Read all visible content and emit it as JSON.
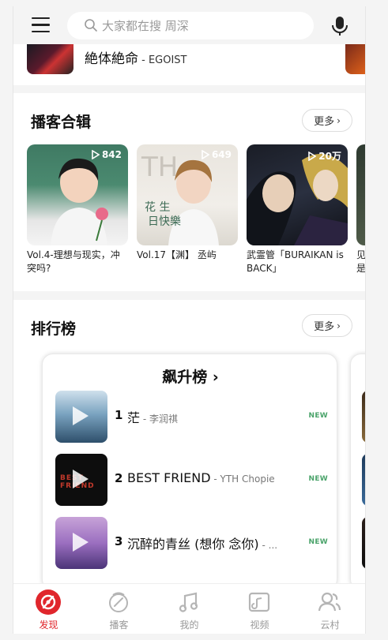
{
  "header": {
    "search_placeholder": "大家都在搜 周深"
  },
  "top_song": {
    "title": "絶体絶命",
    "artist": " - EGOIST"
  },
  "podcast": {
    "title": "播客合辑",
    "more_label": "更多",
    "cards": [
      {
        "count": "842",
        "text": "Vol.4-理想与现实，冲突吗?"
      },
      {
        "count": "649",
        "text": "Vol.17【渊】 丞屿"
      },
      {
        "count": "20万",
        "text": "武霊管「BURAIKAN is BACK」"
      },
      {
        "count": "",
        "text": "见是"
      }
    ]
  },
  "ranking": {
    "title": "排行榜",
    "more_label": "更多",
    "chart_title": "飙升榜",
    "rows": [
      {
        "num": "1",
        "song": "茫",
        "artist": " - 李润祺",
        "badge": "NEW"
      },
      {
        "num": "2",
        "song": "BEST FRIEND",
        "artist": " - YTH Chopie",
        "badge": "NEW"
      },
      {
        "num": "3",
        "song": "沉醉的青丝 (想你 念你)",
        "artist": " - ...",
        "badge": "NEW"
      }
    ]
  },
  "nav": [
    {
      "label": "发现",
      "icon": "discover-icon",
      "active": true
    },
    {
      "label": "播客",
      "icon": "podcast-icon",
      "active": false
    },
    {
      "label": "我的",
      "icon": "music-note-icon",
      "active": false
    },
    {
      "label": "视频",
      "icon": "video-icon",
      "active": false
    },
    {
      "label": "云村",
      "icon": "community-icon",
      "active": false
    }
  ],
  "colors": {
    "accent": "#e0262c",
    "new_badge": "#4aa36a"
  }
}
